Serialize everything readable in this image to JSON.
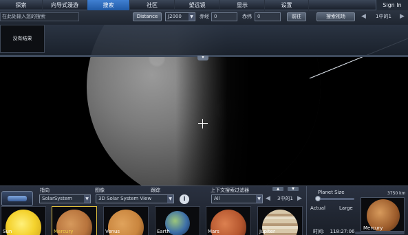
{
  "menu": {
    "tabs": [
      {
        "label": "探索"
      },
      {
        "label": "向导式漫游"
      },
      {
        "label": "搜索"
      },
      {
        "label": "社区"
      },
      {
        "label": "望远镜"
      },
      {
        "label": "显示"
      },
      {
        "label": "设置"
      }
    ],
    "active_index": 2,
    "signin_label": "Sign In"
  },
  "search": {
    "placeholder": "在此处输入您的搜索",
    "distance_label": "Distance",
    "epoch_value": "J2000",
    "ra_label": "赤经",
    "ra_value": "0",
    "dec_label": "赤纬",
    "dec_value": "0",
    "go_label": "前往",
    "search_view_label": "搜索视场",
    "page_indicator": "1中的1"
  },
  "results": {
    "empty_label": "没有结果"
  },
  "context": {
    "pointing_label": "指向",
    "image_label": "图像",
    "tracking_label": "跟踪",
    "filter_label": "上下文搜索过滤器",
    "pointing_value": "SolarSystem",
    "image_value": "3D Solar System View",
    "filter_value": "All",
    "page_indicator": "3中的1",
    "info_label": "i",
    "thumbnails": [
      {
        "name": "Sun",
        "color": "#f4d22e"
      },
      {
        "name": "Mercury",
        "color": "#b7733c",
        "selected": true
      },
      {
        "name": "Venus",
        "color": "#c9853e"
      },
      {
        "name": "Earth",
        "color": "#3d6fa8"
      },
      {
        "name": "Mars",
        "color": "#b5562e"
      },
      {
        "name": "Jupiter",
        "color": "#c9b79a"
      }
    ]
  },
  "planet_panel": {
    "size_label": "Planet Size",
    "actual_label": "Actual",
    "large_label": "Large",
    "distance_readout": "3750 km",
    "preview_name": "Mercury",
    "time_label": "时间:",
    "time_value": "118:27:06"
  }
}
